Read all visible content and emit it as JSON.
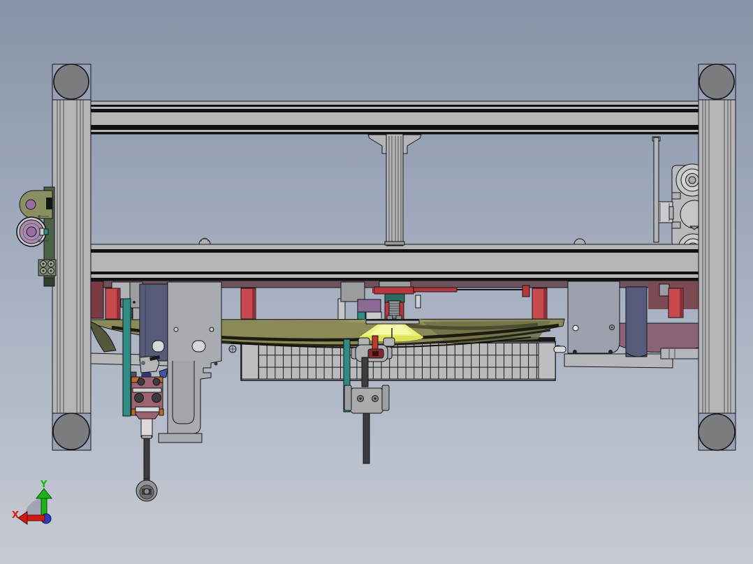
{
  "scene": {
    "type": "cad-3d-viewport",
    "triad": {
      "x_label": "X",
      "y_label": "Y"
    }
  },
  "parts": [
    "extrusion-frame",
    "corner-caps",
    "center-post",
    "gusset-brackets",
    "left-belt-pulley-assembly",
    "right-motor-stack",
    "mounting-plates",
    "red-standoffs",
    "shock-spring-mount",
    "suction-cone",
    "wire-basket",
    "carrier-plates",
    "pneumatic-gripper",
    "probe-rod",
    "ball-end",
    "guide-bars",
    "orientation-triad"
  ],
  "palette": {
    "bgTop": "#8893a7",
    "bgMid": "#a3adbe",
    "bgBottom": "#c6cad3",
    "frame": "#b3b5b8",
    "capFace": "#98a0b4",
    "capDisc": "#7b7c7f",
    "motor": "#c6c8cb",
    "motorLight": "#d2d4d7",
    "navy": "#565b79",
    "navyDark": "#4a4f66",
    "plate": "#a8abb0",
    "plateBlue": "#9da1ae",
    "silver": "#d5d7d9",
    "red": "#c8494e",
    "redDark": "#8e2f35",
    "flange": "#b6383c",
    "maroon": "#6d545c",
    "maroonDark": "#7a3b42",
    "maroonWall": "#7c4a52",
    "teal": "#2f8c84",
    "tealDark": "#2e6b63",
    "olive": "#8a8a58",
    "oliveLight": "#97975f",
    "oliveDark": "#55563a",
    "oliveShade": "#6f7047",
    "bracketOlive": "#8a8f62",
    "green": "#4c6246",
    "greenDark": "#2f4030",
    "sage": "#78836f",
    "sageLight": "#9aa48f",
    "mauve": "#8c6277",
    "purple": "#9b7fa5",
    "plum": "#8d6a96",
    "hub": "#9a6fa4",
    "pulley": "#a98bb0",
    "yellow": "#edf07e",
    "yellowHi": "#f5f8a6",
    "yellowLo": "#dfe356",
    "yellowTop": "#c9cd52",
    "pink": "#9c6470",
    "orange": "#c06a28",
    "indigo": "#4253a0",
    "indigoDark": "#2a3878",
    "whitey": "#dcd9d8",
    "springy": "#939598",
    "rod": "#3c3c3e",
    "ball": "#939395",
    "ballDark": "#6e6e70",
    "grid": "#b7b9bc",
    "gridLine": "#161616",
    "redPin": "#c0392b",
    "redHub": "#7e2a2e",
    "screwDark": "#3c3c40",
    "axisX": "#d11b10",
    "axisY": "#18b418",
    "axisZ": "#2a3bc8",
    "triadShadow": "#9ba1ae"
  }
}
